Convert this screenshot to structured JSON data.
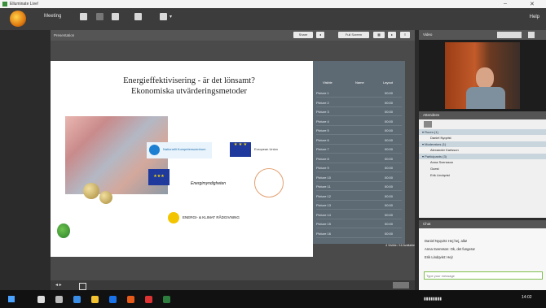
{
  "window": {
    "title": "Elluminate Live!"
  },
  "toolbar": {
    "meeting_label": "Meeting",
    "help_label": "Help"
  },
  "presentation": {
    "header_title": "Presentation",
    "button_labels": [
      "Share",
      "Full Screen"
    ],
    "slide": {
      "title_line1": "Energieffektivisering - är det lönsamt?",
      "title_line2": "Ekonomiska utvärderingsmetoder",
      "logos": [
        "Nationellt Kompetenscentrum",
        "European Union",
        "Energimyndigheten",
        "ENERGI- & KLIMAT RÅDGIVNING"
      ]
    },
    "right_panel": {
      "headers": [
        "Visible",
        "Name",
        "Layout"
      ],
      "rows": [
        [
          "Picture 1",
          "00:00"
        ],
        [
          "Picture 2",
          "00:00"
        ],
        [
          "Picture 3",
          "00:00"
        ],
        [
          "Picture 4",
          "00:00"
        ],
        [
          "Picture 5",
          "00:00"
        ],
        [
          "Picture 6",
          "00:00"
        ],
        [
          "Picture 7",
          "00:00"
        ],
        [
          "Picture 8",
          "00:00"
        ],
        [
          "Picture 9",
          "00:00"
        ],
        [
          "Picture 10",
          "00:00"
        ],
        [
          "Picture 11",
          "00:00"
        ],
        [
          "Picture 12",
          "00:00"
        ],
        [
          "Picture 13",
          "00:00"
        ],
        [
          "Picture 14",
          "00:00"
        ],
        [
          "Picture 15",
          "00:00"
        ],
        [
          "Picture 16",
          "00:00"
        ]
      ],
      "footer": "4 Visible / 16 Available"
    }
  },
  "video": {
    "header": "Video"
  },
  "attendees": {
    "header": "Attendees",
    "sections": [
      {
        "label": "Room (1)",
        "items": [
          "Daniel Nyqvist"
        ]
      },
      {
        "label": "Moderators (1)",
        "items": [
          "Alexander Karlsson"
        ]
      },
      {
        "label": "Participants (3)",
        "items": [
          "Anna Svensson",
          "Guest",
          "Erik Lindqvist"
        ]
      }
    ]
  },
  "chat": {
    "header": "Chat",
    "lines": [
      "Daniel Nyqvist: Hej hej, alla!",
      "Anna Svensson: Ok, det fungerar",
      "Erik Lindqvist: Hej!"
    ],
    "input_placeholder": "Type your message"
  },
  "taskbar": {
    "clock": "14:02"
  }
}
